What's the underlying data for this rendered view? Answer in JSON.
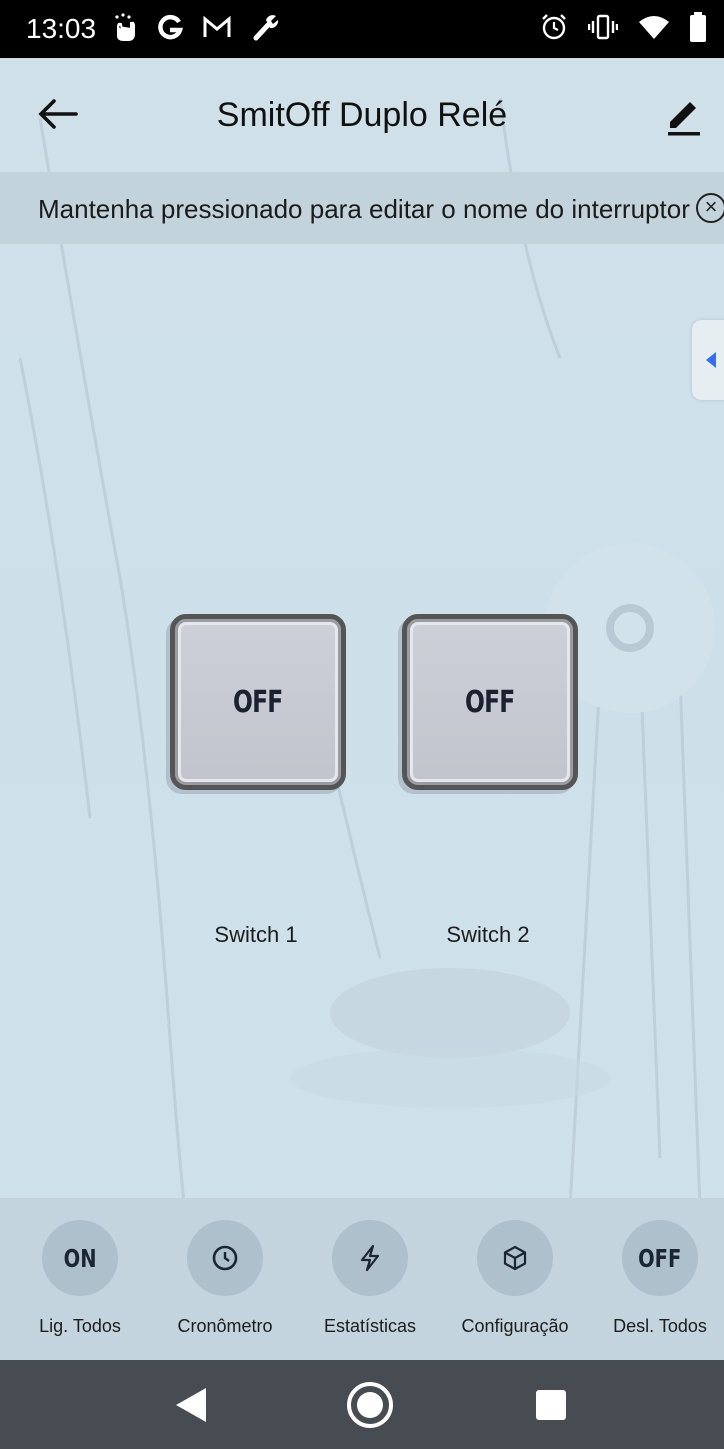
{
  "status_bar": {
    "time": "13:03",
    "left_icons": [
      "hand-icon",
      "google-icon",
      "gmail-icon",
      "wrench-icon"
    ],
    "right_icons": [
      "alarm-icon",
      "vibrate-icon",
      "wifi-icon",
      "battery-icon"
    ]
  },
  "header": {
    "title": "SmitOff Duplo Relé"
  },
  "hint_banner": {
    "text": "Mantenha pressionado para editar o nome do interruptor",
    "close_symbol": "×"
  },
  "switches": [
    {
      "label": "Switch 1",
      "state": "OFF"
    },
    {
      "label": "Switch 2",
      "state": "OFF"
    }
  ],
  "actions": [
    {
      "label": "Lig. Todos",
      "icon_text": "ON",
      "icon": "on-text-icon"
    },
    {
      "label": "Cronômetro",
      "icon": "clock-icon"
    },
    {
      "label": "Estatísticas",
      "icon": "lightning-icon"
    },
    {
      "label": "Configuração",
      "icon": "cube-icon"
    },
    {
      "label": "Desl. Todos",
      "icon_text": "OFF",
      "icon": "off-text-icon"
    }
  ],
  "colors": {
    "background": "#cfdfe8",
    "banner": "#c3d3dc",
    "nav_bar": "#464c52",
    "side_tab_arrow": "#3b6cf0"
  }
}
